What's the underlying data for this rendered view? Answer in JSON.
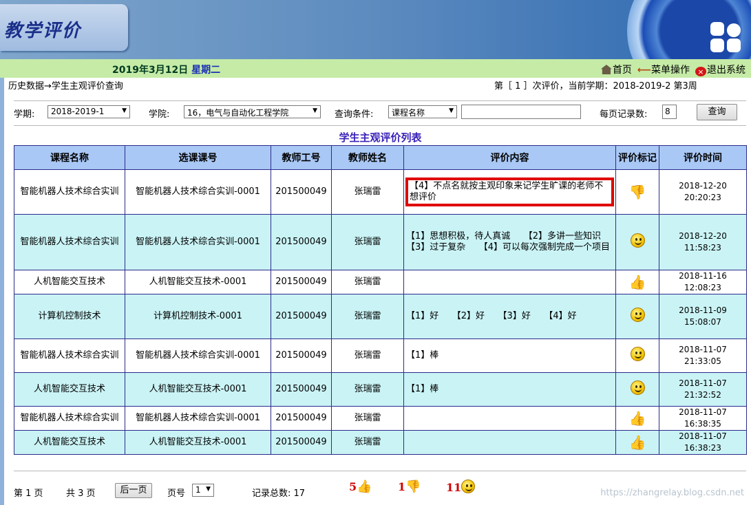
{
  "header": {
    "app_title": "教学评价",
    "date": "2019年3月12日",
    "weekday": "星期二",
    "links": {
      "home": "首页",
      "menu": "菜单操作",
      "exit": "退出系统"
    }
  },
  "breadcrumb": "历史数据→学生主观评价查询",
  "term_info": "第［ 1 ］次评价，当前学期：2018-2019-2 第3周",
  "filters": {
    "semester_label": "学期:",
    "semester_value": "2018-2019-1",
    "college_label": "学院:",
    "college_value": "16，电气与自动化工程学院",
    "query_label": "查询条件:",
    "query_value": "课程名称",
    "query_text": "",
    "page_size_label": "每页记录数:",
    "page_size_value": "8",
    "query_button": "查询"
  },
  "list_title": "学生主观评价列表",
  "table": {
    "headers": [
      "课程名称",
      "选课课号",
      "教师工号",
      "教师姓名",
      "评价内容",
      "评价标记",
      "评价时间"
    ],
    "rows": [
      {
        "course": "智能机器人技术综合实训",
        "course_no": "智能机器人技术综合实训-0001",
        "teacher_id": "201500049",
        "teacher": "张瑞雷",
        "content": "【4】不点名就按主观印象来记学生旷课的老师不想评价",
        "mark": "thumbs-down-icon",
        "date": "2018-12-20",
        "time": "20:20:23"
      },
      {
        "course": "智能机器人技术综合实训",
        "course_no": "智能机器人技术综合实训-0001",
        "teacher_id": "201500049",
        "teacher": "张瑞雷",
        "content": "【1】思想积极，待人真诚　　【2】多讲一些知识　　【3】过于复杂　　【4】可以每次强制完成一个项目",
        "mark": "smiley-icon",
        "date": "2018-12-20",
        "time": "11:58:23"
      },
      {
        "course": "人机智能交互技术",
        "course_no": "人机智能交互技术-0001",
        "teacher_id": "201500049",
        "teacher": "张瑞雷",
        "content": "",
        "mark": "thumbs-up-icon",
        "date": "2018-11-16",
        "time": "12:08:23"
      },
      {
        "course": "计算机控制技术",
        "course_no": "计算机控制技术-0001",
        "teacher_id": "201500049",
        "teacher": "张瑞雷",
        "content": "【1】好　　【2】好　　【3】好　　【4】好",
        "mark": "smiley-icon",
        "date": "2018-11-09",
        "time": "15:08:07"
      },
      {
        "course": "智能机器人技术综合实训",
        "course_no": "智能机器人技术综合实训-0001",
        "teacher_id": "201500049",
        "teacher": "张瑞雷",
        "content": "【1】棒",
        "mark": "smiley-icon",
        "date": "2018-11-07",
        "time": "21:33:05"
      },
      {
        "course": "人机智能交互技术",
        "course_no": "人机智能交互技术-0001",
        "teacher_id": "201500049",
        "teacher": "张瑞雷",
        "content": "【1】棒",
        "mark": "smiley-icon",
        "date": "2018-11-07",
        "time": "21:32:52"
      },
      {
        "course": "智能机器人技术综合实训",
        "course_no": "智能机器人技术综合实训-0001",
        "teacher_id": "201500049",
        "teacher": "张瑞雷",
        "content": "",
        "mark": "thumbs-up-icon",
        "date": "2018-11-07",
        "time": "16:38:35"
      },
      {
        "course": "人机智能交互技术",
        "course_no": "人机智能交互技术-0001",
        "teacher_id": "201500049",
        "teacher": "张瑞雷",
        "content": "",
        "mark": "thumbs-up-icon",
        "date": "2018-11-07",
        "time": "16:38:23"
      }
    ]
  },
  "pager": {
    "current": "第 1 页",
    "total": "共 3 页",
    "next_button": "后一页",
    "page_label": "页号",
    "page_value": "1",
    "record_total": "记录总数: 17"
  },
  "stats": {
    "up": "5",
    "down": "1",
    "smile": "11"
  },
  "watermark": "https://zhangrelay.blog.csdn.net"
}
